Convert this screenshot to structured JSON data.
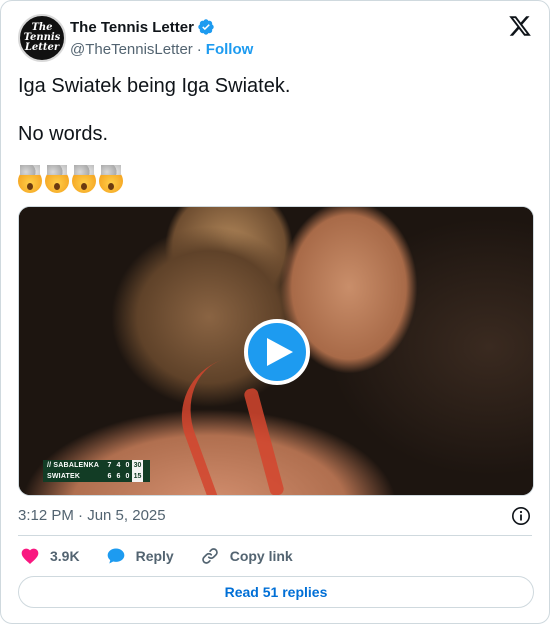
{
  "author": {
    "display_name": "The Tennis Letter",
    "handle": "@TheTennisLetter",
    "separator": "·",
    "follow_label": "Follow",
    "avatar_text": "The Tennis Letter",
    "verified": true
  },
  "tweet": {
    "line1": "Iga Swiatek being Iga Swiatek.",
    "line2": "No words.",
    "emoji_names": [
      "exploding-head-emoji",
      "exploding-head-emoji",
      "exploding-head-emoji",
      "exploding-head-emoji"
    ]
  },
  "media": {
    "type": "video",
    "scoreboard": {
      "rows": [
        {
          "name": "// SABALENKA",
          "s1": "7",
          "s2": "4",
          "s3": "0",
          "pts": "30"
        },
        {
          "name": "SWIATEK",
          "s1": "6",
          "s2": "6",
          "s3": "0",
          "pts": "15"
        }
      ]
    }
  },
  "meta": {
    "timestamp": "3:12 PM · Jun 5, 2025"
  },
  "actions": {
    "likes": "3.9K",
    "reply_label": "Reply",
    "copy_label": "Copy link"
  },
  "footer": {
    "read_replies": "Read 51 replies"
  },
  "colors": {
    "accent": "#1d9bf0",
    "like": "#f91880",
    "link": "#006fd6",
    "muted": "#536471",
    "border": "#cfd9de"
  }
}
